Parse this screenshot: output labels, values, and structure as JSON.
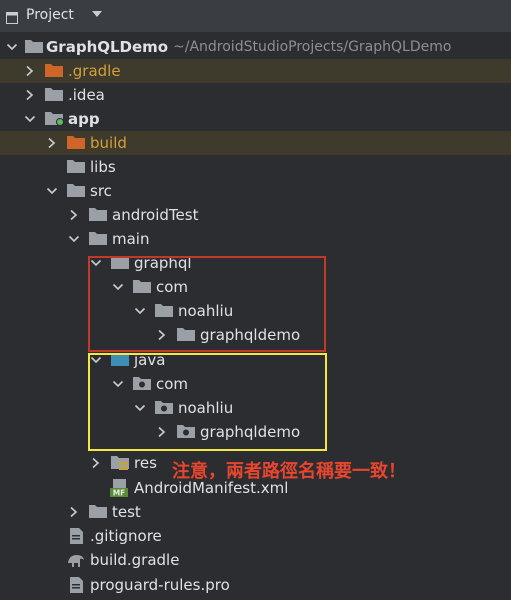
{
  "header": {
    "title": "Project"
  },
  "tree": {
    "root": {
      "label": "GraphQLDemo",
      "path": "~/AndroidStudioProjects/GraphQLDemo"
    },
    "gradle_dir": ".gradle",
    "idea_dir": ".idea",
    "app": "app",
    "build": "build",
    "libs": "libs",
    "src": "src",
    "androidTest": "androidTest",
    "main": "main",
    "graphql": "graphql",
    "graphql_com": "com",
    "graphql_noahliu": "noahliu",
    "graphql_graphqldemo": "graphqldemo",
    "java": "java",
    "java_com": "com",
    "java_noahliu": "noahliu",
    "java_graphqldemo": "graphqldemo",
    "res": "res",
    "manifest": "AndroidManifest.xml",
    "manifest_badge": "MF",
    "test": "test",
    "gitignore": ".gitignore",
    "build_gradle": "build.gradle",
    "proguard": "proguard-rules.pro"
  },
  "annotation": {
    "note": "注意，兩者路徑名稱要一致！"
  },
  "colors": {
    "background": "#2b2d30",
    "folder": "#9aa0a6",
    "excluded_folder": "#d0652a",
    "source_folder": "#3d8fb5",
    "red_box": "#c0392b",
    "yellow_box": "#f3e744",
    "note_text": "#e8452e"
  }
}
